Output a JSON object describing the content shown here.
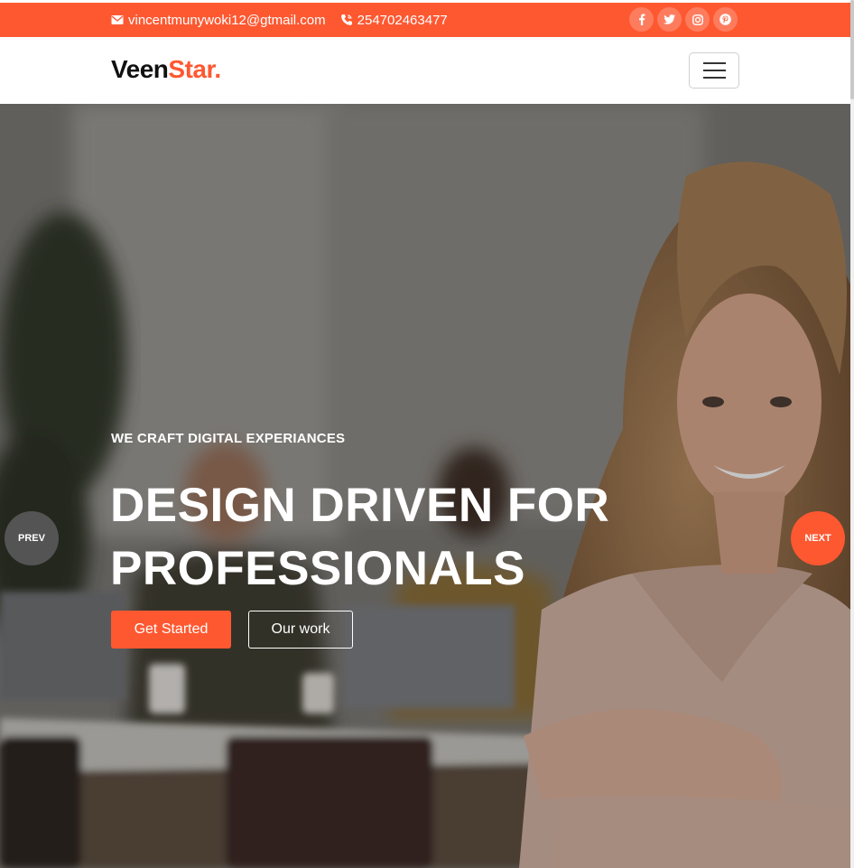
{
  "topbar": {
    "email": "vincentmunywoki12@gtmail.com",
    "phone": "254702463477",
    "socials": [
      "facebook-icon",
      "twitter-icon",
      "instagram-icon",
      "pinterest-icon"
    ]
  },
  "brand": {
    "name_main": "Veen",
    "name_accent": "Star."
  },
  "hero": {
    "subtitle": "WE CRAFT DIGITAL EXPERIANCES",
    "title_line1": "DESIGN DRIVEN FOR",
    "title_line2": "PROFESSIONALS",
    "primary_button": "Get Started",
    "secondary_button": "Our work",
    "prev_label": "PREV",
    "next_label": "NEXT"
  },
  "colors": {
    "accent": "#fe5831",
    "topbar_text": "#ffffff",
    "logo_text": "#111111"
  }
}
